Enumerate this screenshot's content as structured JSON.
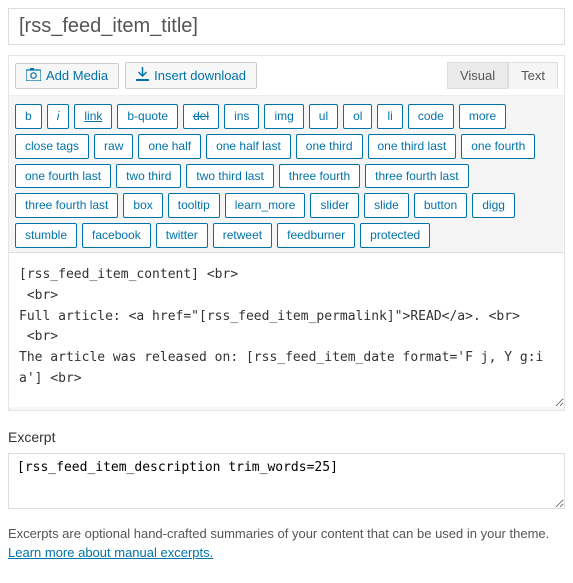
{
  "title": {
    "value": "[rss_feed_item_title]"
  },
  "toolbar": {
    "add_media": "Add Media",
    "insert_download": "Insert download"
  },
  "tabs": {
    "visual": "Visual",
    "text": "Text"
  },
  "quicktags": [
    "b",
    "i",
    "link",
    "b-quote",
    "del",
    "ins",
    "img",
    "ul",
    "ol",
    "li",
    "code",
    "more",
    "close tags",
    "raw",
    "one half",
    "one half last",
    "one third",
    "one third last",
    "one fourth",
    "one fourth last",
    "two third",
    "two third last",
    "three fourth",
    "three fourth last",
    "three fourth last",
    "box",
    "tooltip",
    "learn_more",
    "slider",
    "slide",
    "button",
    "digg",
    "stumble",
    "facebook",
    "twitter",
    "retweet",
    "feedburner",
    "protected"
  ],
  "content": "[rss_feed_item_content] <br>\n <br>\nFull article: <a href=\"[rss_feed_item_permalink]\">READ</a>. <br>\n <br>\nThe article was released on: [rss_feed_item_date format='F j, Y g:i a'] <br>",
  "excerpt": {
    "label": "Excerpt",
    "value": "[rss_feed_item_description trim_words=25]",
    "help": "Excerpts are optional hand-crafted summaries of your content that can be used in your theme.",
    "help_link": "Learn more about manual excerpts."
  }
}
